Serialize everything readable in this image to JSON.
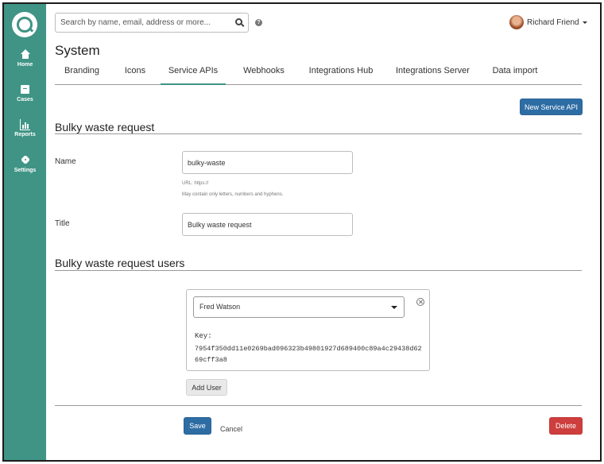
{
  "sidebar": {
    "items": [
      {
        "label": "Home",
        "icon": "home-icon"
      },
      {
        "label": "Cases",
        "icon": "cases-icon"
      },
      {
        "label": "Reports",
        "icon": "reports-icon"
      },
      {
        "label": "Settings",
        "icon": "gear-icon"
      }
    ]
  },
  "search": {
    "placeholder": "Search by name, email, address or more..."
  },
  "user": {
    "name": "Richard Friend"
  },
  "page": {
    "title": "System"
  },
  "tabs": [
    "Branding",
    "Icons",
    "Service APIs",
    "Webhooks",
    "Integrations Hub",
    "Integrations Server",
    "Data import"
  ],
  "active_tab": "Service APIs",
  "actions": {
    "new_service_api": "New Service API"
  },
  "service": {
    "heading": "Bulky waste request",
    "name_label": "Name",
    "name_value": "bulky-waste",
    "url_help": "URL: https://",
    "name_help": "May contain only letters, numbers and hyphens.",
    "title_label": "Title",
    "title_value": "Bulky waste request"
  },
  "users_section": {
    "heading": "Bulky waste request users",
    "selected_user": "Fred Watson",
    "key_label": "Key:",
    "key_value": "7954f350dd11e0269bad096323b49801927d689400c89a4c29438d6269cff3a8",
    "add_user": "Add User"
  },
  "footer": {
    "save": "Save",
    "cancel": "Cancel",
    "delete": "Delete"
  },
  "colors": {
    "sidebar": "#3f9485",
    "primary": "#2e6da4",
    "danger": "#cd3e3c"
  }
}
